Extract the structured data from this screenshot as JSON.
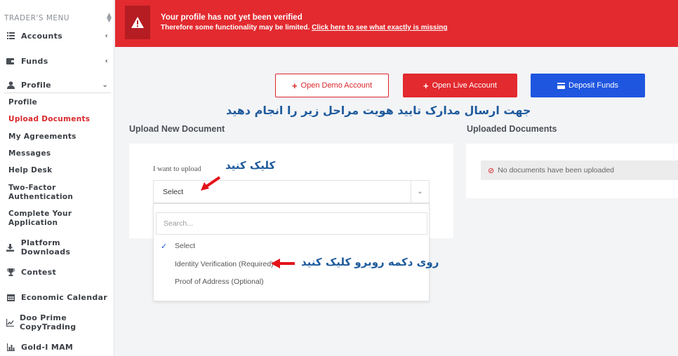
{
  "sidebar": {
    "header": "TRADER'S MENU",
    "items": [
      {
        "label": "Accounts",
        "icon": "list-icon"
      },
      {
        "label": "Funds",
        "icon": "wallet-icon"
      },
      {
        "label": "Profile",
        "icon": "user-icon"
      },
      {
        "label": "Platform Downloads",
        "icon": "download-icon"
      },
      {
        "label": "Contest",
        "icon": "trophy-icon"
      },
      {
        "label": "Economic Calendar",
        "icon": "calendar-icon"
      },
      {
        "label": "Doo Prime CopyTrading",
        "icon": "chart-line-icon"
      },
      {
        "label": "Gold-I MAM",
        "icon": "bar-chart-icon"
      }
    ],
    "profile_sub": [
      {
        "label": "Profile",
        "active": false
      },
      {
        "label": "Upload Documents",
        "active": true
      },
      {
        "label": "My Agreements",
        "active": false
      },
      {
        "label": "Messages",
        "active": false
      },
      {
        "label": "Help Desk",
        "active": false
      },
      {
        "label": "Two-Factor Authentication",
        "active": false
      },
      {
        "label": "Complete Your Application",
        "active": false
      }
    ]
  },
  "banner": {
    "title": "Your profile has not yet been verified",
    "subtitle": "Therefore some functionality may be limited.",
    "link": "Click here to see what exactly is missing"
  },
  "actions": {
    "demo": "Open Demo Account",
    "live": "Open Live Account",
    "deposit": "Deposit Funds"
  },
  "annotations": {
    "instruction": "جهت ارسال مدارک تایید هویت مراحل زیر را انجام دهید",
    "click": "کلیک کنید",
    "click_button": "روی دکمه روبرو کلیک کنید"
  },
  "upload": {
    "title": "Upload New Document",
    "label": "I want to upload",
    "selected": "Select",
    "search_placeholder": "Search...",
    "options": [
      "Select",
      "Identity Verification (Required)",
      "Proof of Address (Optional)"
    ]
  },
  "uploaded": {
    "title": "Uploaded Documents",
    "empty": "No documents have been uploaded"
  },
  "colors": {
    "brand_red": "#e22a2f",
    "primary_blue": "#1f56e0",
    "annotation_blue": "#1e5a9c"
  }
}
